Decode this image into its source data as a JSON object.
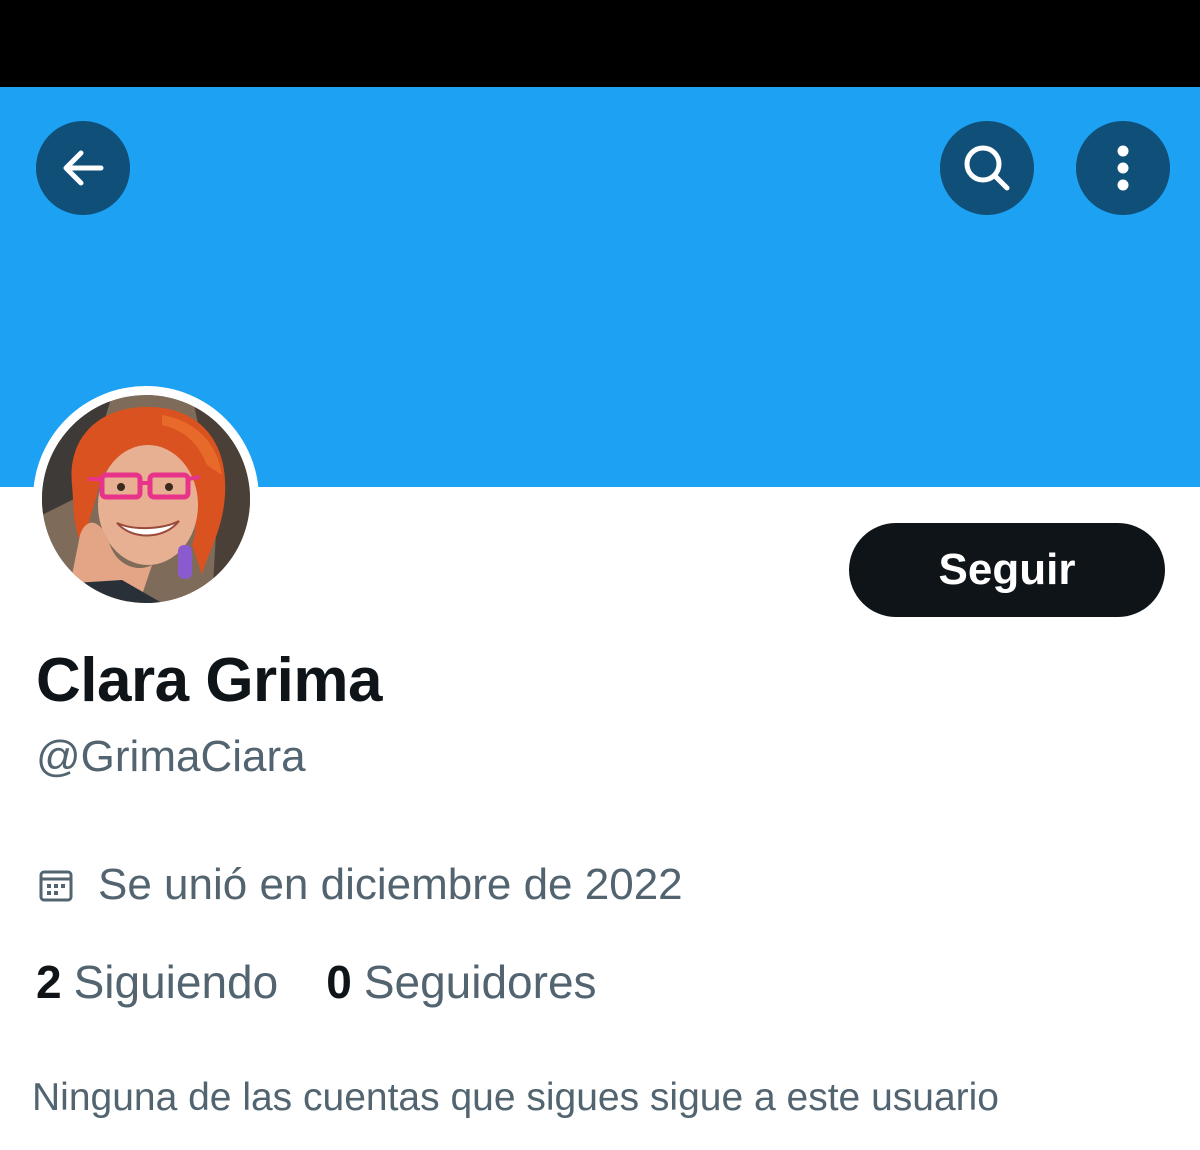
{
  "header": {
    "back_icon": "arrow-left-icon",
    "search_icon": "search-icon",
    "more_icon": "more-vertical-icon",
    "banner_color": "#1DA1F2",
    "button_bg": "#0F4F78"
  },
  "profile": {
    "display_name": "Clara Grima",
    "handle": "@GrimaCiara",
    "follow_label": "Seguir",
    "joined_icon": "calendar-icon",
    "joined": "Se unió en diciembre de 2022",
    "following_count": "2",
    "following_label": "Siguiendo",
    "followers_count": "0",
    "followers_label": "Seguidores",
    "mutual_text": "Ninguna de las cuentas que sigues sigue a este usuario"
  }
}
